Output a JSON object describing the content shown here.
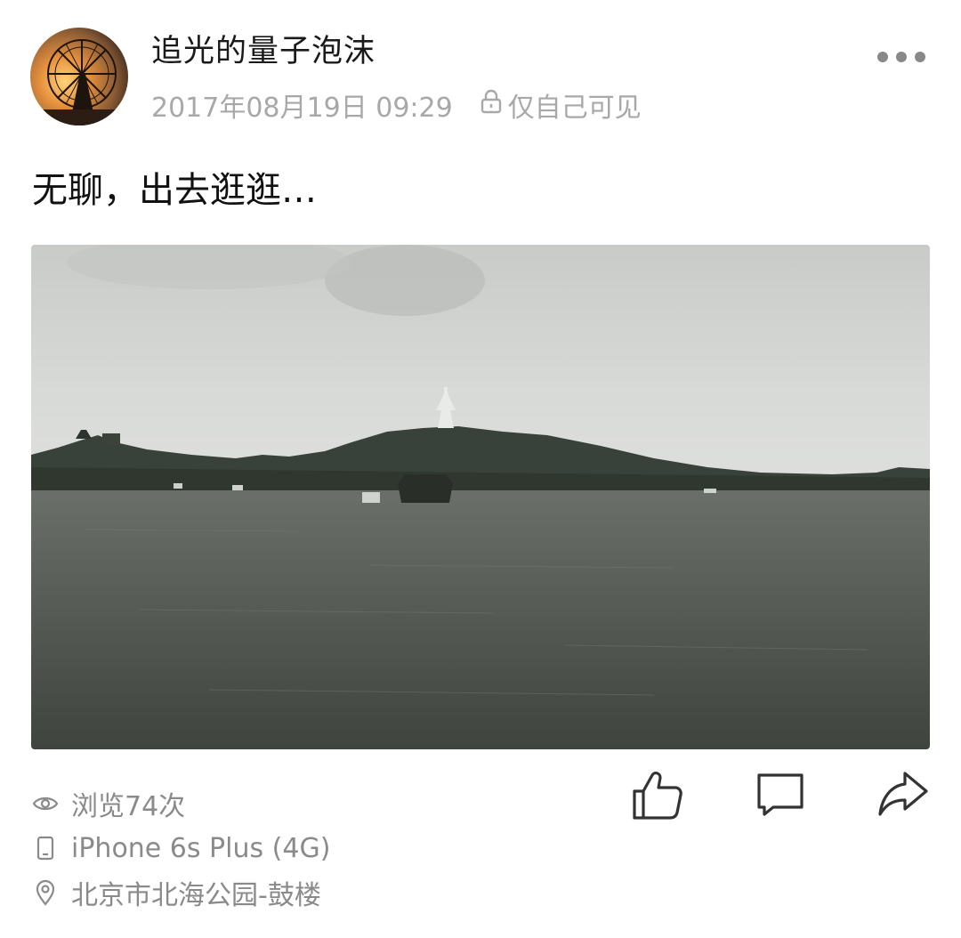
{
  "post": {
    "username": "追光的量子泡沫",
    "timestamp": "2017年08月19日 09:29",
    "privacy_label": "仅自己可见",
    "text": "无聊，出去逛逛…"
  },
  "footer": {
    "views": "浏览74次",
    "device": "iPhone 6s Plus (4G)",
    "location": "北京市北海公园-鼓楼"
  },
  "icons": {
    "more": "more-icon",
    "privacy": "lock-icon",
    "views": "eye-icon",
    "device": "phone-icon",
    "location": "location-pin-icon",
    "like": "thumbs-up-icon",
    "comment": "comment-icon",
    "share": "share-icon"
  },
  "colors": {
    "text_primary": "#1a1a1a",
    "text_secondary": "#a8a8a8",
    "icon": "#333333"
  }
}
